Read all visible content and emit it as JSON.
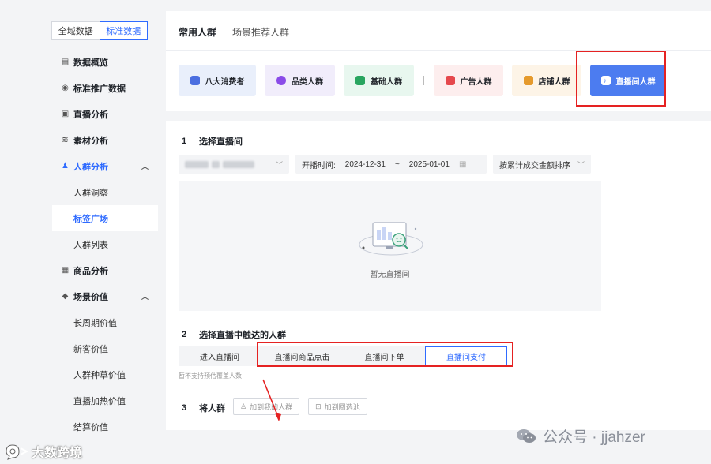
{
  "sidebar": {
    "scope": [
      {
        "label": "全域数据",
        "active": false
      },
      {
        "label": "标准数据",
        "active": true
      }
    ],
    "menu": [
      {
        "label": "数据概览",
        "icon": "chart-icon"
      },
      {
        "label": "标准推广数据",
        "icon": "promo-icon"
      },
      {
        "label": "直播分析",
        "icon": "live-icon"
      },
      {
        "label": "素材分析",
        "icon": "layers-icon"
      },
      {
        "label": "人群分析",
        "icon": "users-icon",
        "open": true
      },
      {
        "label": "人群洞察"
      },
      {
        "label": "标签广场",
        "active": true
      },
      {
        "label": "人群列表"
      },
      {
        "label": "商品分析",
        "icon": "bag-icon"
      },
      {
        "label": "场景价值",
        "icon": "diamond-icon",
        "open": true
      },
      {
        "label": "长周期价值"
      },
      {
        "label": "新客价值"
      },
      {
        "label": "人群种草价值"
      },
      {
        "label": "直播加热价值"
      },
      {
        "label": "结算价值"
      }
    ]
  },
  "main": {
    "tabs": [
      {
        "label": "常用人群",
        "active": true
      },
      {
        "label": "场景推荐人群",
        "active": false
      }
    ],
    "cards": [
      {
        "label": "八大消费者",
        "bg": "#e9effb",
        "icon_color": "#4a6ee0"
      },
      {
        "label": "品类人群",
        "bg": "#f1edfb",
        "icon_color": "#8a4be8"
      },
      {
        "label": "基础人群",
        "bg": "#e8f7ef",
        "icon_color": "#28a55f"
      },
      {
        "label": "广告人群",
        "bg": "#fdeeee",
        "icon_color": "#e5484d"
      },
      {
        "label": "店铺人群",
        "bg": "#fdf4e7",
        "icon_color": "#e59a2c"
      },
      {
        "label": "直播间人群",
        "bg": "#4c7cf0",
        "icon_color": "#ffffff",
        "selected": true
      }
    ],
    "step1": {
      "num": "1",
      "title": "选择直播间"
    },
    "filters": {
      "date_label": "开播时间:",
      "date_start": "2024-12-31",
      "date_sep": "~",
      "date_end": "2025-01-01",
      "sort": "按累计成交金额排序"
    },
    "empty_text": "暂无直播间",
    "step2": {
      "num": "2",
      "title": "选择直播中触达的人群"
    },
    "segments": [
      {
        "label": "进入直播间",
        "active": false
      },
      {
        "label": "直播间商品点击",
        "active": false
      },
      {
        "label": "直播间下单",
        "active": false
      },
      {
        "label": "直播间支付",
        "active": true
      }
    ],
    "hint": "暂不支持预估覆盖人数",
    "step3": {
      "num": "3",
      "title": "将人群"
    },
    "actions": {
      "add_crowd": "加到我的人群",
      "add_pool": "加到圈选池"
    }
  },
  "watermark": {
    "text": "公众号 · jjahzer"
  },
  "logo": {
    "text": "大数跨境"
  },
  "colors": {
    "accent": "#2f6bff",
    "highlight": "#e52222"
  }
}
